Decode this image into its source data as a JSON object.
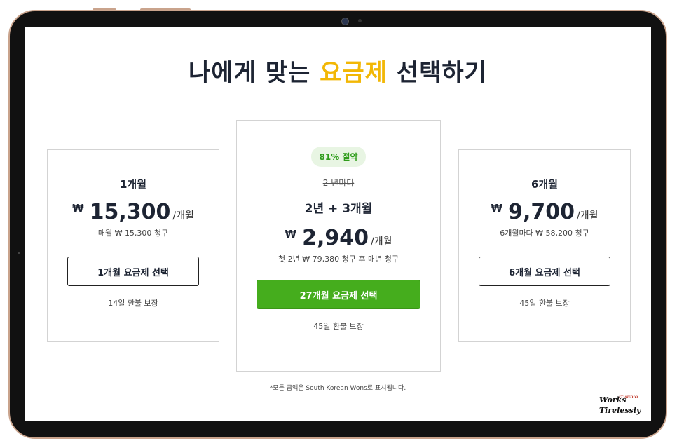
{
  "headline": {
    "before": "나에게 맞는 ",
    "accent": "요금제",
    "after": " 선택하기",
    "accent_color": "#f2b705"
  },
  "plans": [
    {
      "name": "1개월",
      "currency": "₩",
      "price": "15,300",
      "unit": "/개월",
      "billing": "매월 ₩ 15,300 청구",
      "button": "1개월 요금제 선택",
      "refund": "14일 환불 보장"
    },
    {
      "badge": "81% 절약",
      "strike": "2 년마다",
      "name": "2년 + 3개월",
      "currency": "₩",
      "price": "2,940",
      "unit": "/개월",
      "billing": "첫 2년 ₩ 79,380 청구 후 매년 청구",
      "button": "27개월 요금제 선택",
      "refund": "45일 환불 보장",
      "button_color": "#45ad1d"
    },
    {
      "name": "6개월",
      "currency": "₩",
      "price": "9,700",
      "unit": "/개월",
      "billing": "6개월마다 ₩ 58,200 청구",
      "button": "6개월 요금제 선택",
      "refund": "45일 환불 보장"
    }
  ],
  "footnote": "*모든 금액은 South Korean Wons로 표시됩니다.",
  "watermark": {
    "line1": "Works",
    "tag": "IT AUDIO",
    "line2": "Tirelessly"
  }
}
